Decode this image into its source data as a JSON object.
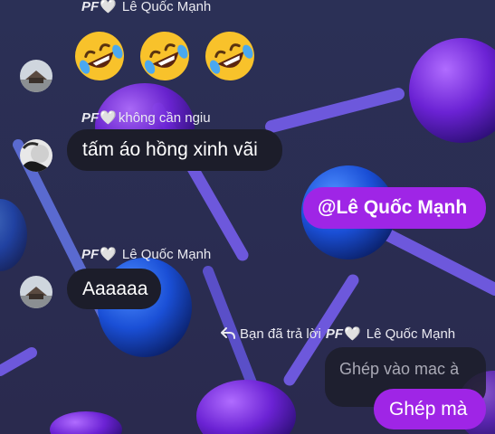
{
  "colors": {
    "background": "#2a2f52",
    "bubble_dark": "#1c1d2a",
    "bubble_purple": "#9f25e6",
    "lollipop_purple": "#7a35e0",
    "lollipop_blue": "#1d5fe8",
    "stick": "#6a55d8",
    "text": "#ffffff",
    "sender_text": "#e9e9f0"
  },
  "messages": [
    {
      "sender_prefix": "PF",
      "sender_heart": "🤍",
      "sender_name": "Lê Quốc Mạnh",
      "emojis": [
        "rolling-on-floor-laughing-emoji",
        "rolling-on-floor-laughing-emoji",
        "rolling-on-floor-laughing-emoji"
      ]
    },
    {
      "sender_prefix": "PF",
      "sender_heart": "🤍",
      "sender_name": "không cần ngiu",
      "text": "tấm áo hồng xinh vãi"
    },
    {
      "outgoing": true,
      "text": "@Lê Quốc Mạnh"
    },
    {
      "sender_prefix": "PF",
      "sender_heart": "🤍",
      "sender_name": "Lê Quốc Mạnh",
      "text": "Aaaaaa"
    },
    {
      "outgoing": true,
      "reply_icon": "reply-arrow-icon",
      "reply_label": "Bạn đã trả lời",
      "reply_to_prefix": "PF",
      "reply_to_heart": "🤍",
      "reply_to_name": "Lê Quốc Mạnh",
      "quoted_text": "Ghép vào mac à",
      "text": "Ghép mà"
    }
  ]
}
